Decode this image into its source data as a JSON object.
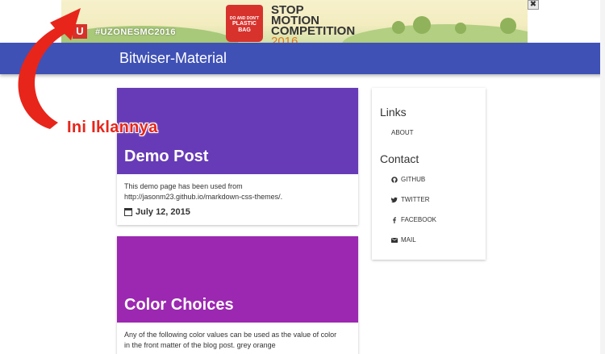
{
  "ad": {
    "hashtag": "#UZONESMC2016",
    "logo": "U",
    "bag_small": "DO AND DON'T",
    "bag_big": "PLASTIC BAG",
    "line1": "STOP",
    "line2": "MOTION",
    "line3": "COMPETITION",
    "year": "2016",
    "close": "✖"
  },
  "header": {
    "site_title": "Bitwiser-Material",
    "color": "#3f51b5"
  },
  "posts": [
    {
      "title": "Demo Post",
      "banner_color": "#673ab7",
      "line1": "This demo page has been used from",
      "line2": "http://jasonm23.github.io/markdown-css-themes/.",
      "date": "July 12, 2015"
    },
    {
      "title": "Color Choices",
      "banner_color": "#9c27b0",
      "line1": "Any of the following color values can be used as the value of color",
      "line2": "in the front matter of the blog post. grey orange"
    }
  ],
  "sidebar": {
    "links_heading": "Links",
    "links": [
      {
        "label": "ABOUT"
      }
    ],
    "contact_heading": "Contact",
    "contact": [
      {
        "label": "GITHUB",
        "icon": "github-icon"
      },
      {
        "label": "TWITTER",
        "icon": "twitter-icon"
      },
      {
        "label": "FACEBOOK",
        "icon": "facebook-icon"
      },
      {
        "label": "MAIL",
        "icon": "mail-icon"
      }
    ]
  },
  "annotation": {
    "text": "Ini Iklannya",
    "color": "#e8251b"
  }
}
